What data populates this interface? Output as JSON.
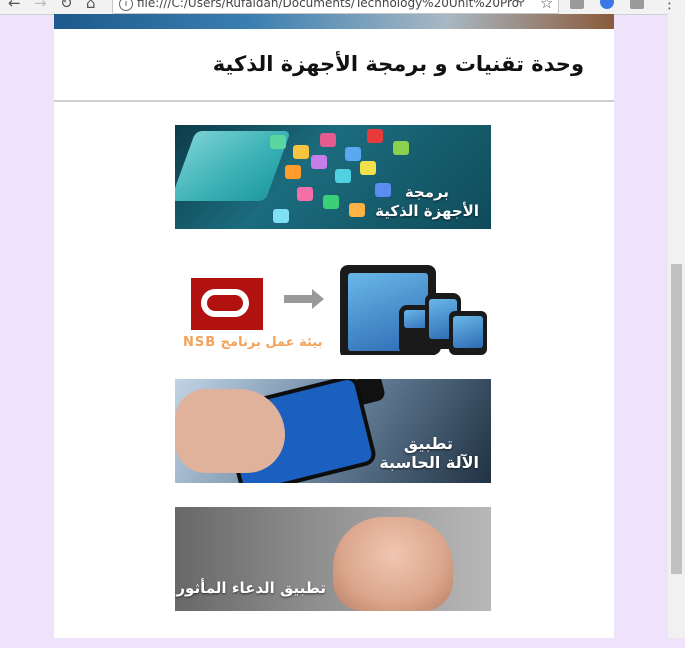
{
  "browser": {
    "address": "file:///C:/Users/Rufaidah/Documents/Technology%20Unit%20Pro",
    "info_glyph": "i"
  },
  "page": {
    "title": "وحدة تقنيات و برمجة الأجهزة الذكية"
  },
  "tiles": [
    {
      "lines": [
        "برمجة",
        "الأجهزة الذكية"
      ]
    },
    {
      "lines": [
        "بيئة عمل برنامج NSB"
      ]
    },
    {
      "lines": [
        "تطبيق",
        "الآلة الحاسبة"
      ]
    },
    {
      "lines": [
        "تطبيق الدعاء المأثور"
      ]
    }
  ],
  "colors": {
    "page_background": "#efe3fb",
    "nsb_logo": "#b1110f",
    "nsb_caption": "#f3a25a"
  }
}
